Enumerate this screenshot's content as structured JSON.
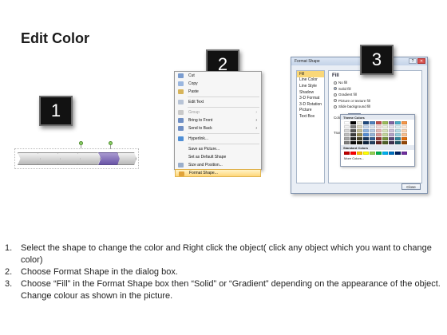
{
  "page": {
    "title": "Edit Color"
  },
  "badges": [
    "1",
    "2",
    "3"
  ],
  "context_menu": {
    "items": [
      {
        "label": "Cut",
        "color": "#7a9ccf",
        "dim": false,
        "arrow": ""
      },
      {
        "label": "Copy",
        "color": "#9ab6df",
        "dim": false,
        "arrow": ""
      },
      {
        "label": "Paste",
        "color": "#d7b45a",
        "dim": false,
        "arrow": ""
      },
      {
        "sep": true
      },
      {
        "label": "Edit Text",
        "color": "#b8c4d6",
        "dim": false,
        "arrow": ""
      },
      {
        "sep": true
      },
      {
        "label": "Group",
        "color": "#c9c9c9",
        "dim": true,
        "arrow": "›"
      },
      {
        "label": "Bring to Front",
        "color": "#6f8fc4",
        "dim": false,
        "arrow": "›"
      },
      {
        "label": "Send to Back",
        "color": "#6f8fc4",
        "dim": false,
        "arrow": "›"
      },
      {
        "sep": true
      },
      {
        "label": "Hyperlink...",
        "color": "#4f8fd6",
        "dim": false,
        "arrow": ""
      },
      {
        "sep": true
      },
      {
        "label": "Save as Picture...",
        "color": "",
        "dim": false,
        "arrow": ""
      },
      {
        "label": "Set as Default Shape",
        "color": "",
        "dim": false,
        "arrow": ""
      },
      {
        "label": "Size and Position...",
        "color": "#9aaecb",
        "dim": false,
        "arrow": ""
      },
      {
        "label": "Format Shape...",
        "color": "#e0a33a",
        "dim": false,
        "arrow": "",
        "highlight": true
      }
    ]
  },
  "dialog": {
    "title": "Format Shape",
    "nav": [
      "Fill",
      "Line Color",
      "Line Style",
      "Shadow",
      "3-D Format",
      "3-D Rotation",
      "Picture",
      "Text Box"
    ],
    "fill_heading": "Fill",
    "options": [
      {
        "label": "No fill",
        "selected": false
      },
      {
        "label": "Solid fill",
        "selected": true
      },
      {
        "label": "Gradient fill",
        "selected": false
      },
      {
        "label": "Picture or texture fill",
        "selected": false
      },
      {
        "label": "Slide background fill",
        "selected": false
      }
    ],
    "color_label": "Color:",
    "transparency_label": "Transpa",
    "close_label": "Close",
    "palette": {
      "theme_heading": "Theme Colors",
      "standard_heading": "Standard Colors",
      "more_label": "More Colors...",
      "theme_top": [
        "#ffffff",
        "#000000",
        "#eeece1",
        "#1f497d",
        "#4f81bd",
        "#c0504d",
        "#9bbb59",
        "#8064a2",
        "#4bacc6",
        "#f79646"
      ],
      "theme_shades": [
        [
          "#f2f2f2",
          "#7f7f7f",
          "#ddd9c3",
          "#c6d9f0",
          "#dbe5f1",
          "#f2dcdb",
          "#ebf1dd",
          "#e5e0ec",
          "#dbeef3",
          "#fdeada"
        ],
        [
          "#d8d8d8",
          "#595959",
          "#c4bd97",
          "#8db3e2",
          "#b8cce4",
          "#e5b9b7",
          "#d7e3bc",
          "#ccc1d9",
          "#b7dde8",
          "#fbd5b5"
        ],
        [
          "#bfbfbf",
          "#3f3f3f",
          "#938953",
          "#548dd4",
          "#95b3d7",
          "#d99694",
          "#c3d69b",
          "#b2a2c7",
          "#92cddc",
          "#fac08f"
        ],
        [
          "#a5a5a5",
          "#262626",
          "#494429",
          "#17365d",
          "#366092",
          "#953734",
          "#76923c",
          "#5f497a",
          "#31859b",
          "#e36c09"
        ],
        [
          "#7f7f7f",
          "#0c0c0c",
          "#1d1b10",
          "#0f243e",
          "#244061",
          "#632423",
          "#4f6128",
          "#3f3151",
          "#205867",
          "#974806"
        ]
      ],
      "standard": [
        "#c00000",
        "#ff0000",
        "#ffc000",
        "#ffff00",
        "#92d050",
        "#00b050",
        "#00b0f0",
        "#0070c0",
        "#002060",
        "#7030a0"
      ]
    }
  },
  "instructions": [
    {
      "num": "1.",
      "text": "Select the shape to change the color and Right click the object( click any object which you want to change color)"
    },
    {
      "num": "2.",
      "text": "Choose Format Shape in the dialog box."
    },
    {
      "num": "3.",
      "text": "Choose “Fill” in the Format Shape box then “Solid” or “Gradient” depending on the appearance of the object. Change colour as shown in the picture."
    }
  ]
}
